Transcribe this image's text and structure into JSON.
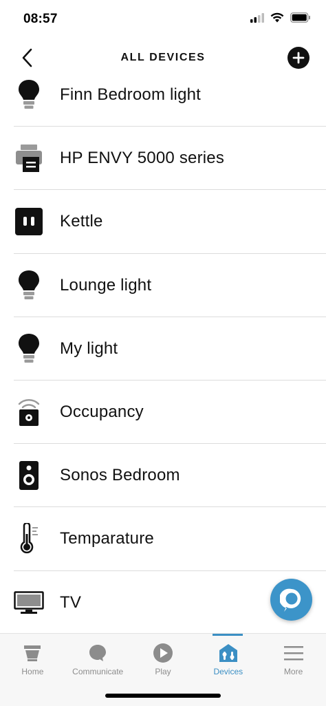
{
  "status_bar": {
    "time": "08:57"
  },
  "header": {
    "title": "ALL DEVICES"
  },
  "devices": [
    {
      "label": "Finn Bedroom light",
      "icon": "bulb-icon"
    },
    {
      "label": "HP ENVY 5000 series",
      "icon": "printer-icon"
    },
    {
      "label": "Kettle",
      "icon": "smart-plug-icon"
    },
    {
      "label": "Lounge light",
      "icon": "bulb-icon"
    },
    {
      "label": "My light",
      "icon": "bulb-icon"
    },
    {
      "label": "Occupancy",
      "icon": "occupancy-sensor-icon"
    },
    {
      "label": "Sonos Bedroom",
      "icon": "speaker-icon"
    },
    {
      "label": "Temparature",
      "icon": "thermometer-icon"
    },
    {
      "label": "TV",
      "icon": "tv-icon"
    }
  ],
  "tabs": [
    {
      "label": "Home",
      "icon": "home-icon",
      "active": false
    },
    {
      "label": "Communicate",
      "icon": "chat-bubble-icon",
      "active": false
    },
    {
      "label": "Play",
      "icon": "play-icon",
      "active": false
    },
    {
      "label": "Devices",
      "icon": "devices-icon",
      "active": true
    },
    {
      "label": "More",
      "icon": "menu-icon",
      "active": false
    }
  ],
  "colors": {
    "accent": "#3b8fc4",
    "alexa": "#3c94c9",
    "icon": "#111111",
    "inactive": "#8c8c8c"
  }
}
